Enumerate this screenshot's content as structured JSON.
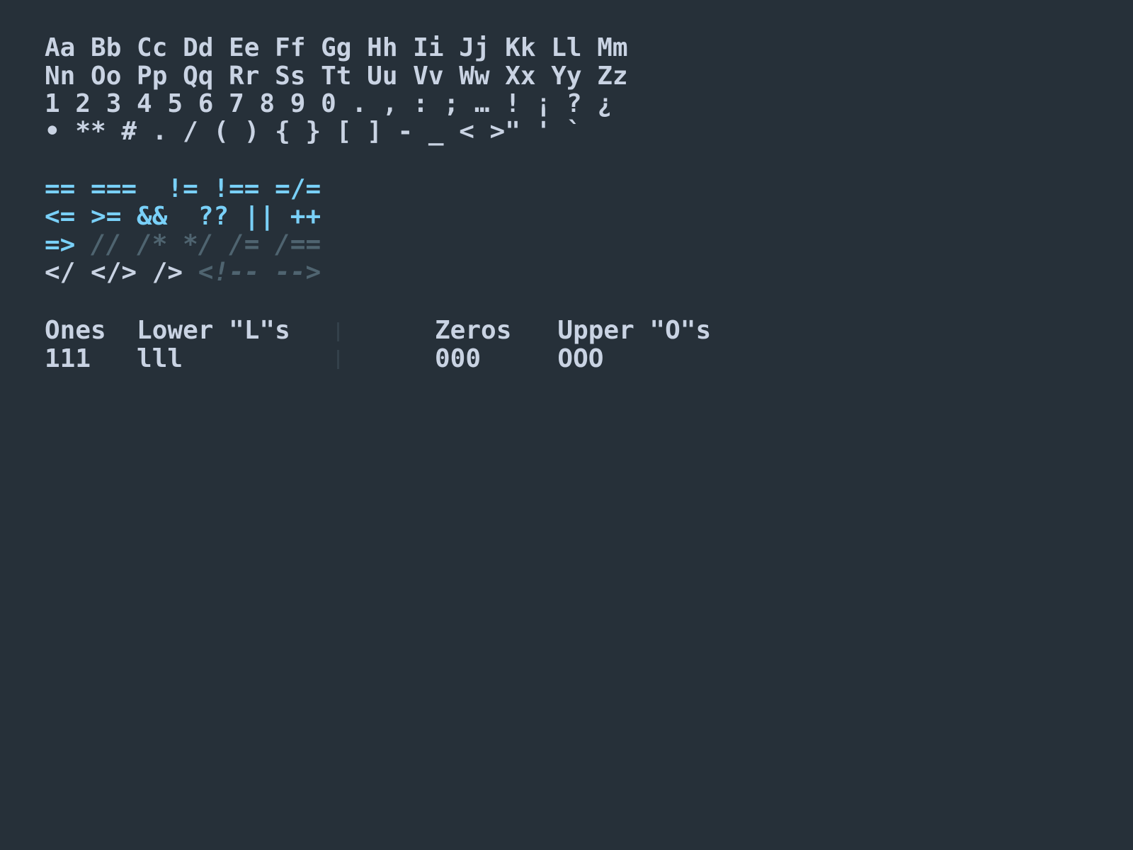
{
  "colors": {
    "background": "#263039",
    "text": "#c9d3e3",
    "operator": "#79d0f8",
    "comment": "#4f6470",
    "indent_guide": "#33404a"
  },
  "alphabet": {
    "line1": "Aa Bb Cc Dd Ee Ff Gg Hh Ii Jj Kk Ll Mm",
    "line2": "Nn Oo Pp Qq Rr Ss Tt Uu Vv Ww Xx Yy Zz",
    "digits_punct": "1 2 3 4 5 6 7 8 9 0 . , : ; … ! ¡ ? ¿",
    "symbols": "• ** # . / ( ) { } [ ] - _ < >\" ' `"
  },
  "ligatures": {
    "eq_row": "== ===  != !== =/=",
    "cmp_row": "<= >= &&  ?? || ++",
    "arrow": "=>",
    "comments_row": "// /* */ /= /==",
    "tags_row": "</ </> />",
    "html_comment": "<!-- -->"
  },
  "comparison": {
    "header_left": "Ones  Lower \"L\"s",
    "header_right": "Zeros   Upper \"O\"s",
    "values_left": "111   lll",
    "values_right": "000     OOO"
  }
}
